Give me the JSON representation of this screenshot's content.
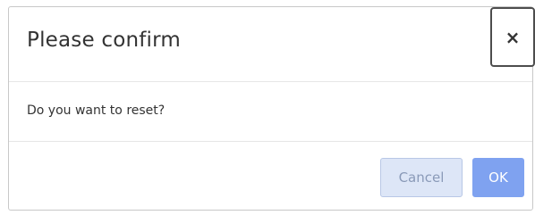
{
  "dialog": {
    "title": "Please confirm",
    "close_label": "×",
    "message": "Do you want to reset?",
    "cancel_label": "Cancel",
    "ok_label": "OK"
  },
  "colors": {
    "cancel_bg": "#dde6f7",
    "ok_bg": "#7fa2f0",
    "text": "#333333"
  },
  "icons": {
    "close": "close-icon"
  }
}
